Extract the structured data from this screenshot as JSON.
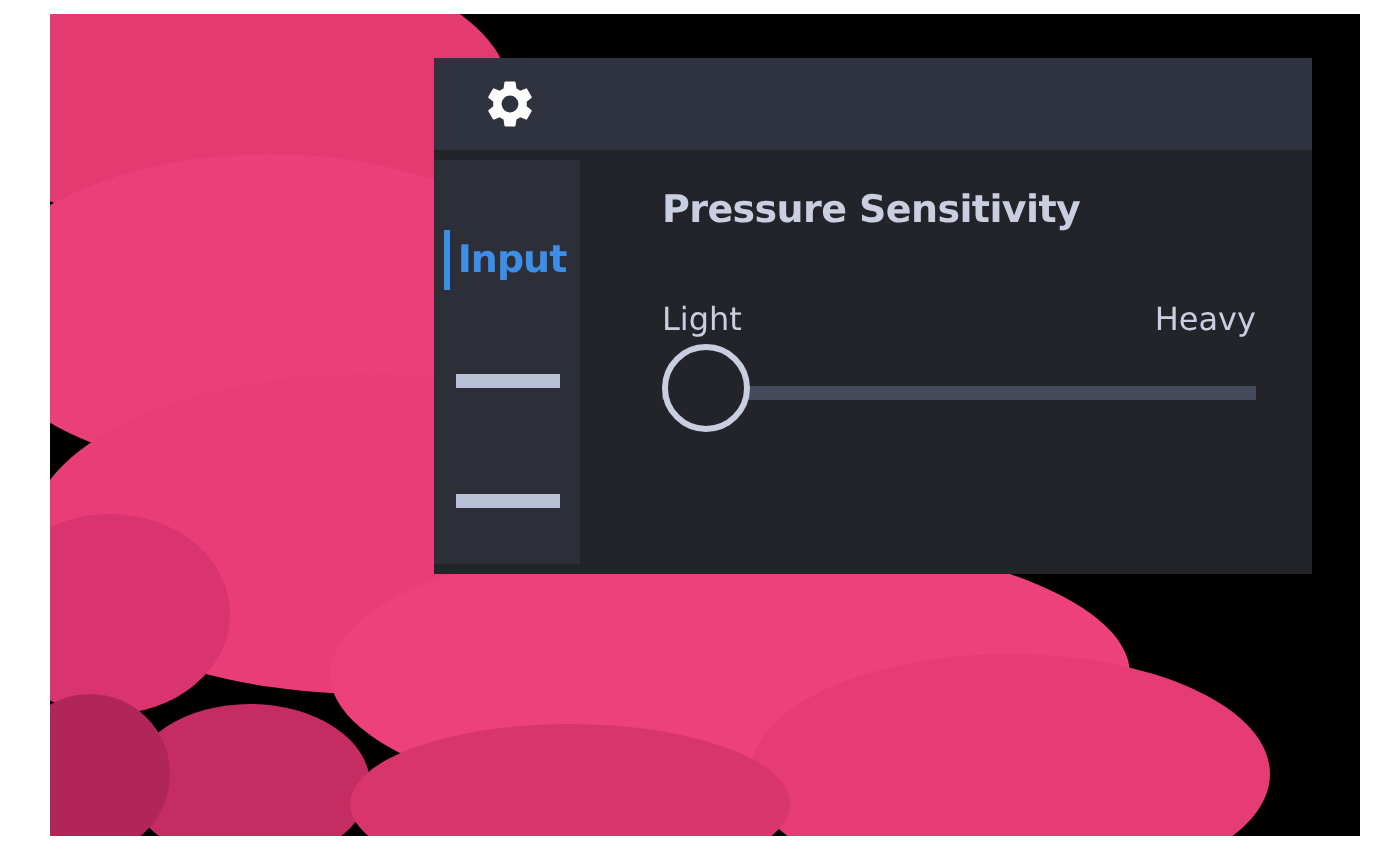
{
  "sidebar": {
    "items": [
      {
        "kind": "label",
        "label": "Input",
        "selected": true
      },
      {
        "kind": "placeholder",
        "selected": false
      },
      {
        "kind": "placeholder",
        "selected": false
      }
    ]
  },
  "section": {
    "title": "Pressure Sensitivity"
  },
  "slider": {
    "min_label": "Light",
    "max_label": "Heavy",
    "level": 0
  }
}
